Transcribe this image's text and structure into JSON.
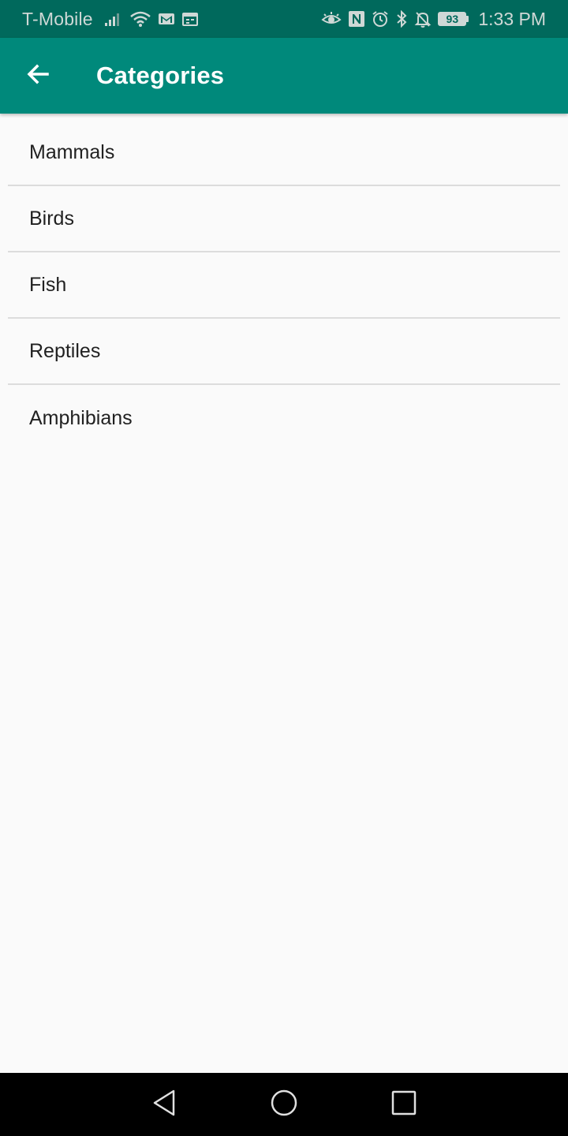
{
  "status_bar": {
    "carrier": "T-Mobile",
    "battery_level": "93",
    "time": "1:33 PM",
    "left_icons": [
      "signal-icon",
      "wifi-icon",
      "gmail-icon",
      "calendar-icon"
    ],
    "right_icons": [
      "eye-icon",
      "nfc-icon",
      "alarm-icon",
      "bluetooth-icon",
      "notifications-off-icon"
    ]
  },
  "app_bar": {
    "title": "Categories",
    "back_icon": "arrow-back-icon"
  },
  "categories": [
    "Mammals",
    "Birds",
    "Fish",
    "Reptiles",
    "Amphibians"
  ],
  "nav_bar": {
    "buttons": [
      "back-nav-icon",
      "home-nav-icon",
      "recents-nav-icon"
    ]
  },
  "colors": {
    "status_bar": "#00695c",
    "app_bar": "#00897b",
    "background": "#fafafa",
    "text": "#212121",
    "divider": "#dcdcdc"
  }
}
